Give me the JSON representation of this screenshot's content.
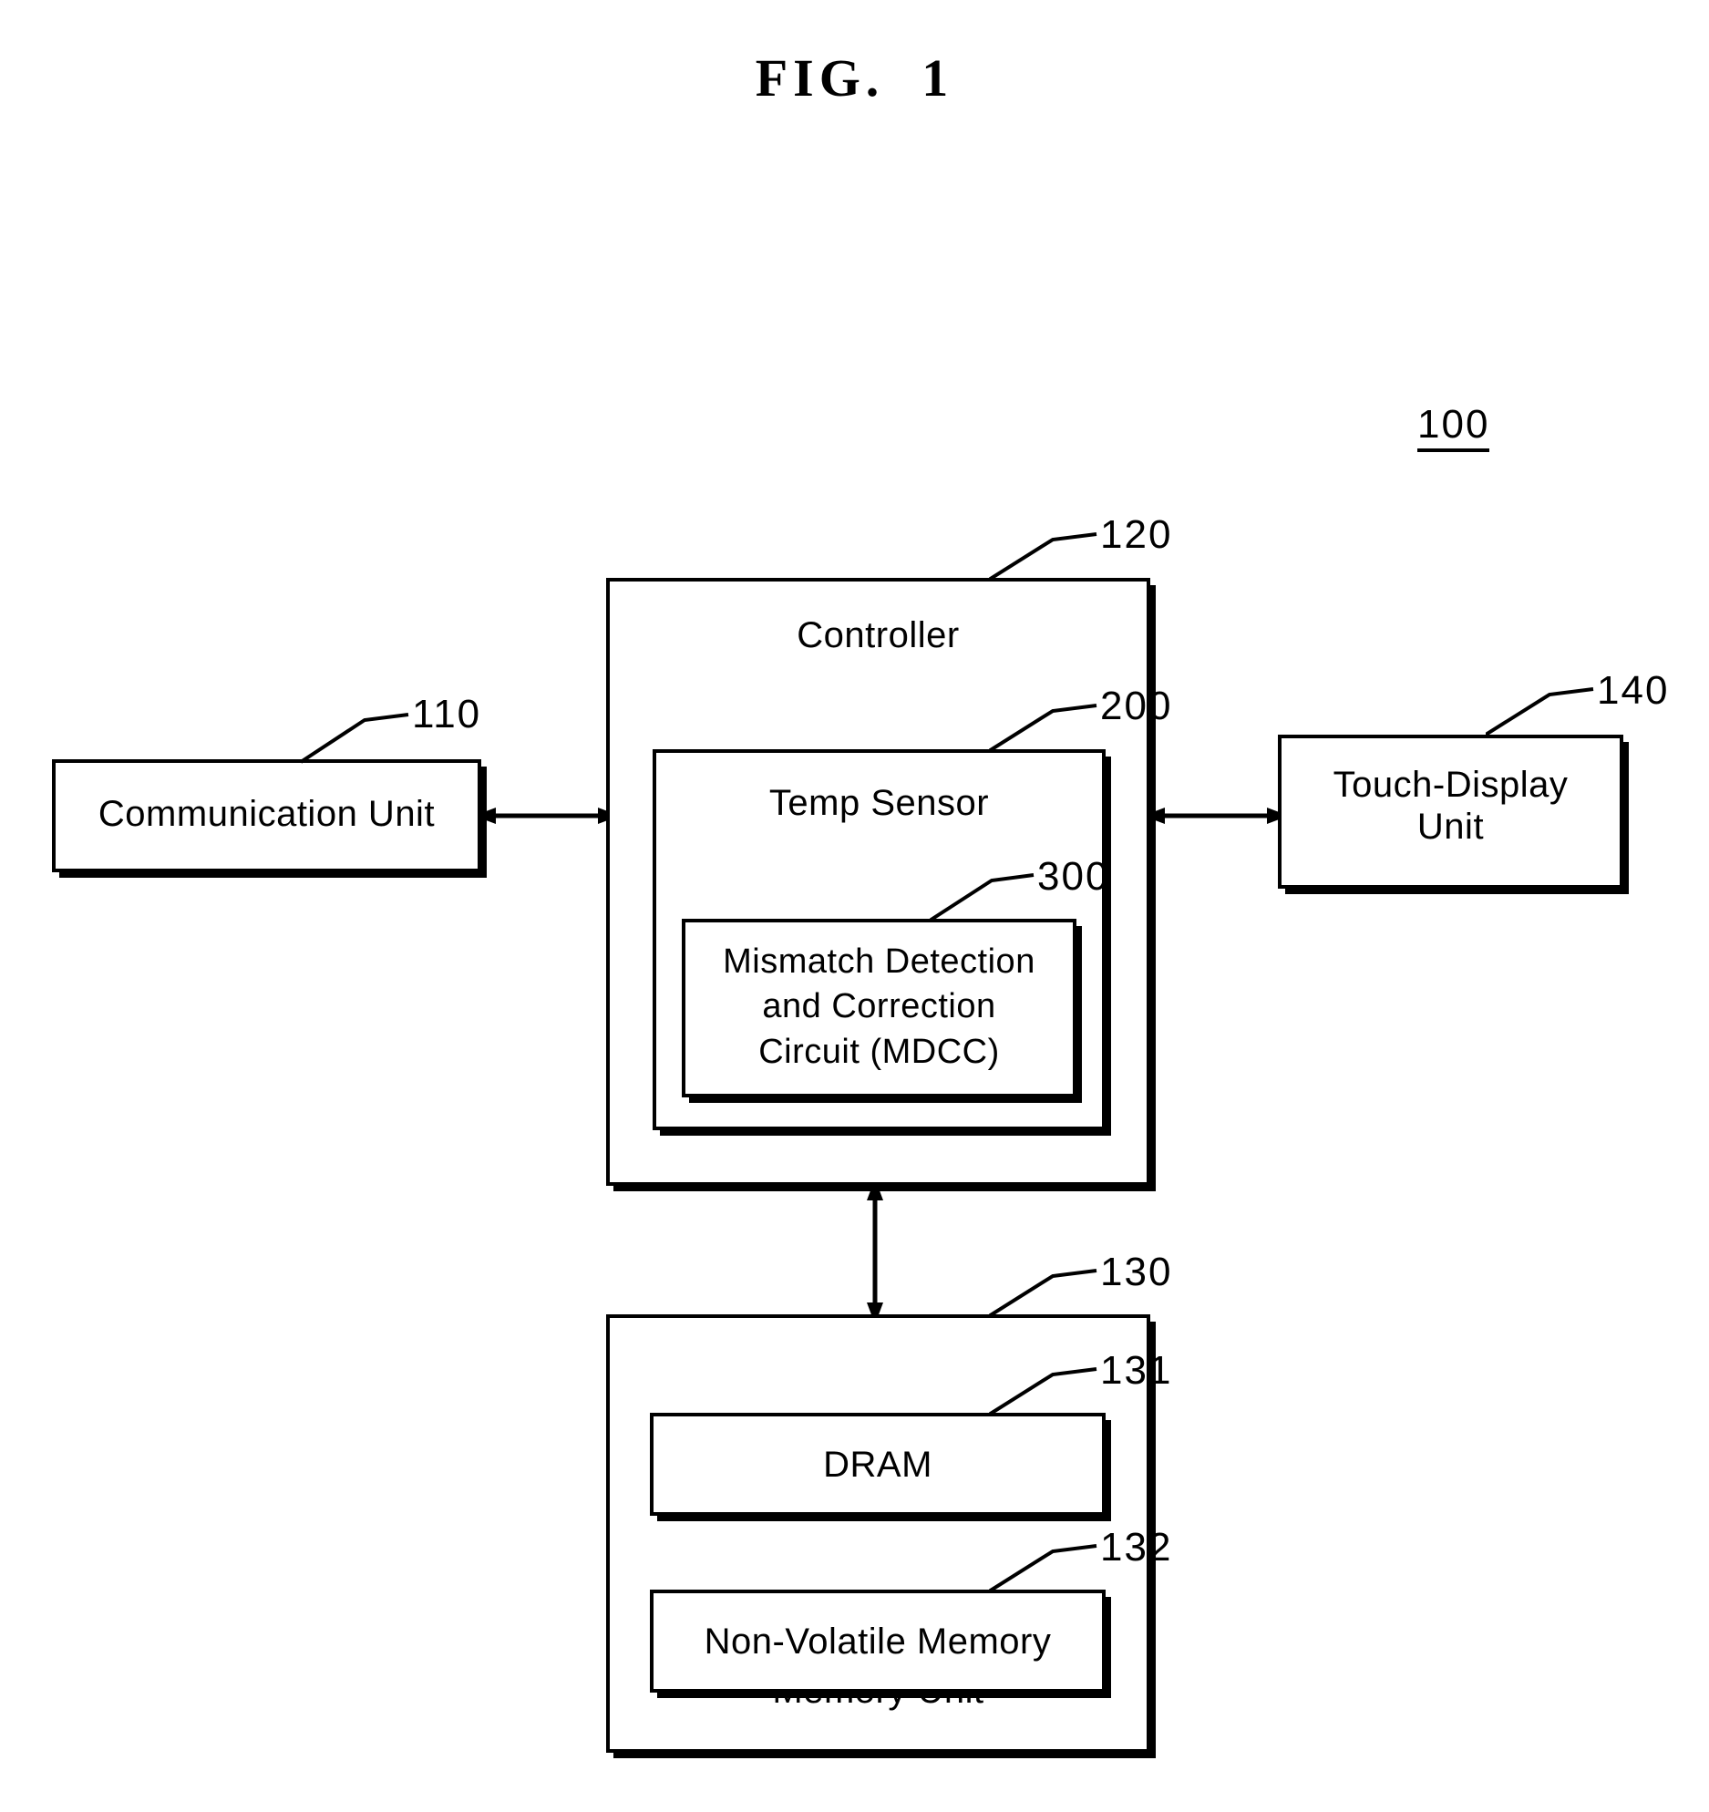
{
  "figure": {
    "title": "FIG.  1",
    "assembly_ref": "100"
  },
  "blocks": {
    "communication_unit": {
      "label": "Communication Unit",
      "ref": "110"
    },
    "controller": {
      "label": "Controller",
      "ref": "120"
    },
    "temp_sensor": {
      "label": "Temp Sensor",
      "ref": "200"
    },
    "mdcc": {
      "label": "Mismatch Detection\nand Correction\nCircuit (MDCC)",
      "ref": "300"
    },
    "touch_display_unit": {
      "label": "Touch-Display\nUnit",
      "ref": "140"
    },
    "memory_unit": {
      "label": "Memory Unit",
      "ref": "130"
    },
    "dram": {
      "label": "DRAM",
      "ref": "131"
    },
    "non_volatile_memory": {
      "label": "Non-Volatile Memory",
      "ref": "132"
    }
  },
  "connectors": [
    {
      "name": "comm-to-controller",
      "from": "communication_unit",
      "to": "controller",
      "style": "double-arrow",
      "orientation": "horizontal"
    },
    {
      "name": "controller-to-touch",
      "from": "controller",
      "to": "touch_display_unit",
      "style": "double-arrow",
      "orientation": "horizontal"
    },
    {
      "name": "controller-to-memory",
      "from": "controller",
      "to": "memory_unit",
      "style": "double-arrow",
      "orientation": "vertical"
    }
  ],
  "colors": {
    "line": "#000000",
    "background": "#ffffff"
  }
}
